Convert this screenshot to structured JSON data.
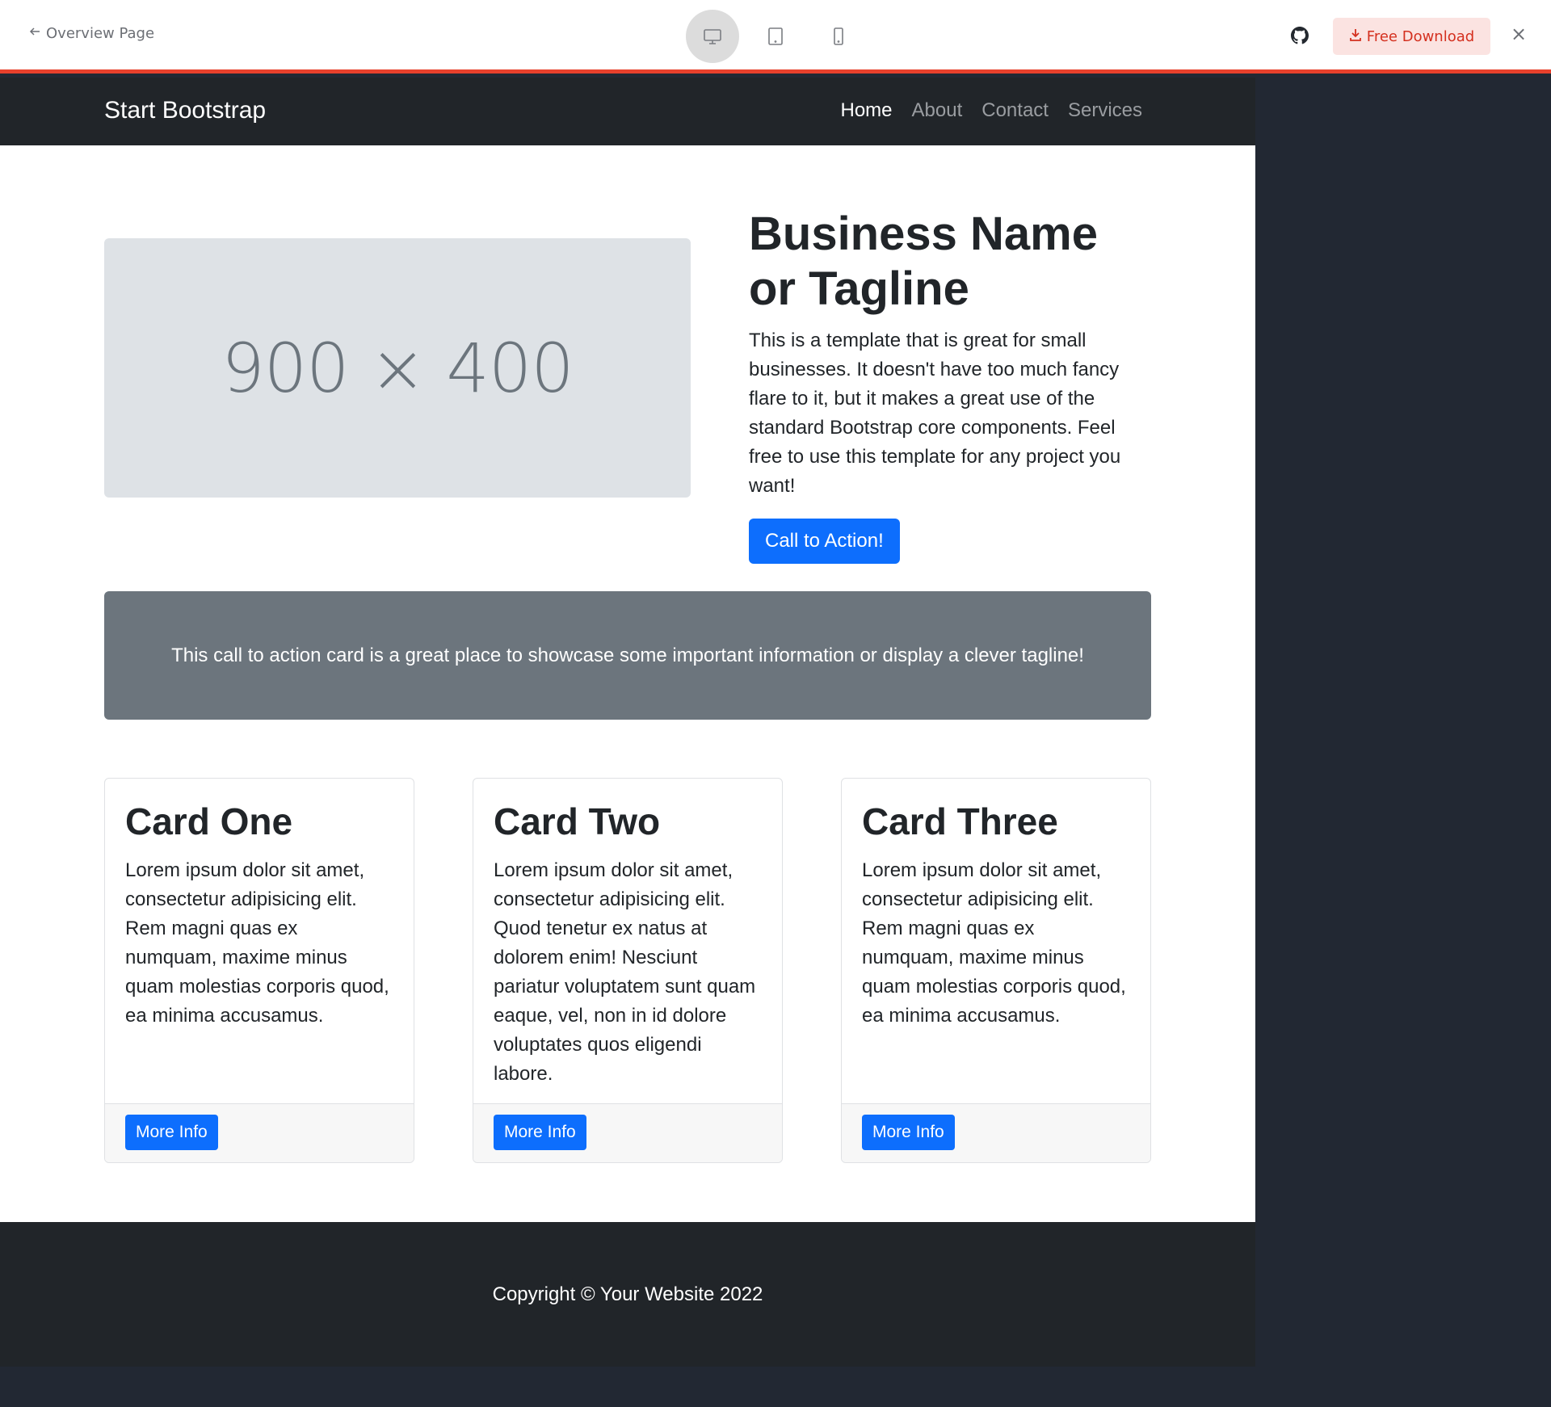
{
  "preview_bar": {
    "back_label": "Overview Page",
    "devices": [
      "desktop-icon",
      "tablet-icon",
      "phone-icon"
    ],
    "active_device": "desktop",
    "download_label": "Free Download",
    "close_glyph": "×",
    "accent_color": "#e8412c"
  },
  "site": {
    "brand": "Start Bootstrap",
    "nav": [
      {
        "label": "Home",
        "active": true
      },
      {
        "label": "About",
        "active": false
      },
      {
        "label": "Contact",
        "active": false
      },
      {
        "label": "Services",
        "active": false
      }
    ],
    "hero": {
      "image_placeholder": "900 × 400",
      "title": "Business Name or Tagline",
      "description": "This is a template that is great for small businesses. It doesn't have too much fancy flare to it, but it makes a great use of the standard Bootstrap core components. Feel free to use this template for any project you want!",
      "cta_label": "Call to Action!"
    },
    "cta_card_text": "This call to action card is a great place to showcase some important information or display a clever tagline!",
    "cards": [
      {
        "title": "Card One",
        "text": "Lorem ipsum dolor sit amet, consectetur adipisicing elit. Rem magni quas ex numquam, maxime minus quam molestias corporis quod, ea minima accusamus.",
        "button": "More Info"
      },
      {
        "title": "Card Two",
        "text": "Lorem ipsum dolor sit amet, consectetur adipisicing elit. Quod tenetur ex natus at dolorem enim! Nesciunt pariatur voluptatem sunt quam eaque, vel, non in id dolore voluptates quos eligendi labore.",
        "button": "More Info"
      },
      {
        "title": "Card Three",
        "text": "Lorem ipsum dolor sit amet, consectetur adipisicing elit. Rem magni quas ex numquam, maxime minus quam molestias corporis quod, ea minima accusamus.",
        "button": "More Info"
      }
    ],
    "footer": "Copyright © Your Website 2022",
    "colors": {
      "primary": "#0d6efd",
      "dark": "#212529",
      "secondary": "#6c757d",
      "placeholder_bg": "#dee2e6"
    }
  }
}
